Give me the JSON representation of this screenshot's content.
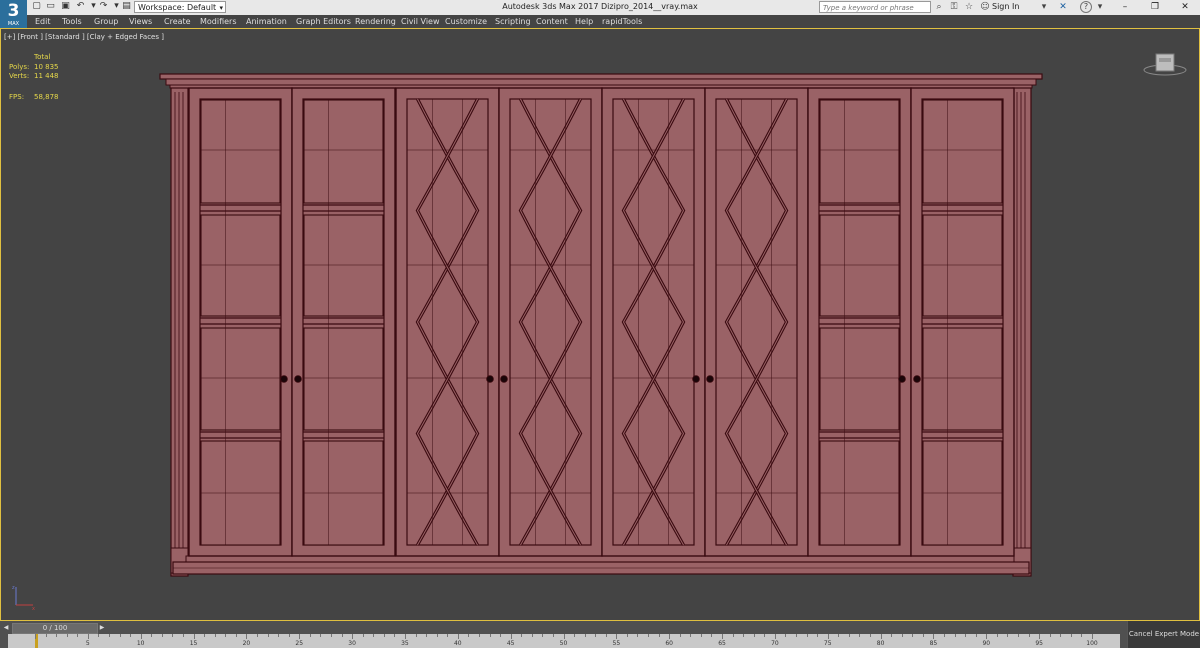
{
  "app": {
    "logo_text": "3",
    "logo_sub": "MAX",
    "window_title": "Autodesk 3ds Max 2017     Dizipro_2014__vray.max"
  },
  "quick_access": {
    "icons": [
      "new-file-icon",
      "open-file-icon",
      "save-icon",
      "undo-icon",
      "redo-icon",
      "project-folder-icon"
    ],
    "workspace_label": "Workspace: Default"
  },
  "titlebar": {
    "search_placeholder": "Type a keyword or phrase",
    "sign_in": "Sign In",
    "help": "?"
  },
  "menu": {
    "items": [
      "Edit",
      "Tools",
      "Group",
      "Views",
      "Create",
      "Modifiers",
      "Animation",
      "Graph Editors",
      "Rendering",
      "Civil View",
      "Customize",
      "Scripting",
      "Content",
      "Help",
      "rapidTools"
    ]
  },
  "viewport": {
    "label": "[+] [Front ] [Standard ] [Clay + Edged Faces ]",
    "stats": {
      "header": "Total",
      "polys_label": "Polys:",
      "polys_value": "10 835",
      "verts_label": "Verts:",
      "verts_value": "11 448",
      "fps_label": "FPS:",
      "fps_value": "58,878"
    },
    "colors": {
      "background": "#444444",
      "model_fill": "#9a6266",
      "model_edge": "#3a0a10",
      "active_border": "#e0c040"
    }
  },
  "timeline": {
    "slider_label": "0 / 100",
    "ticks": [
      "0",
      "5",
      "10",
      "15",
      "20",
      "25",
      "30",
      "35",
      "40",
      "45",
      "50",
      "55",
      "60",
      "65",
      "70",
      "75",
      "80",
      "85",
      "90",
      "95",
      "100"
    ]
  },
  "status": {
    "cancel_expert": "Cancel Expert Mode"
  }
}
